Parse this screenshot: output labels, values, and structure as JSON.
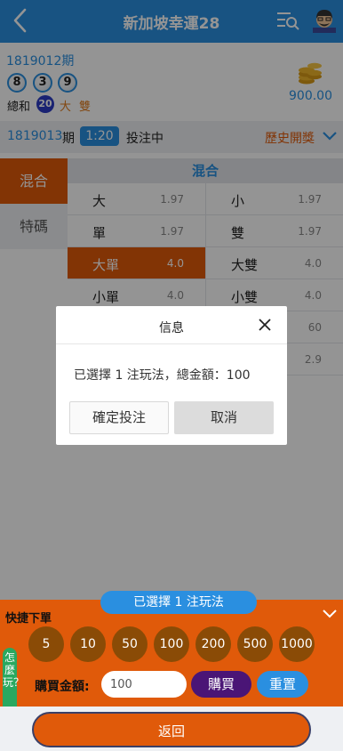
{
  "header": {
    "title": "新加坡幸運28",
    "back_icon": "chevron-left-icon",
    "menu_icon": "list-search-icon",
    "avatar_icon": "user-avatar-icon"
  },
  "last_draw": {
    "issue": "1819012期",
    "balls": [
      "8",
      "3",
      "9"
    ],
    "sum_label": "總和",
    "sum": "20",
    "attr_size": "大",
    "attr_parity": "雙",
    "balance": "900.00",
    "coins_icon": "coins-stack-icon"
  },
  "current": {
    "issue": "1819013",
    "issue_suffix": "期",
    "timer": "1:20",
    "status": "投注中",
    "history_label": "歷史開獎"
  },
  "tabs": [
    {
      "label": "混合",
      "active": true
    },
    {
      "label": "特碼",
      "active": false
    }
  ],
  "grid": {
    "header": "混合",
    "rows": [
      [
        {
          "name": "大",
          "odds": "1.97",
          "selected": false
        },
        {
          "name": "小",
          "odds": "1.97",
          "selected": false
        }
      ],
      [
        {
          "name": "單",
          "odds": "1.97",
          "selected": false
        },
        {
          "name": "雙",
          "odds": "1.97",
          "selected": false
        }
      ],
      [
        {
          "name": "大單",
          "odds": "4.0",
          "selected": true
        },
        {
          "name": "大雙",
          "odds": "4.0",
          "selected": false
        }
      ],
      [
        {
          "name": "小單",
          "odds": "4.0",
          "selected": false
        },
        {
          "name": "小雙",
          "odds": "4.0",
          "selected": false
        }
      ],
      [
        {
          "name": "",
          "odds": "",
          "selected": false
        },
        {
          "name": "",
          "odds": "60",
          "selected": false
        }
      ],
      [
        {
          "name": "",
          "odds": "",
          "selected": false
        },
        {
          "name": "",
          "odds": "2.9",
          "selected": false
        }
      ]
    ]
  },
  "dialog": {
    "title": "信息",
    "message": "已選擇 1 注玩法，總金額：100",
    "confirm_label": "確定投注",
    "cancel_label": "取消"
  },
  "bet_panel": {
    "selected_label": "已選擇 1 注玩法",
    "quick_label": "快捷下單",
    "howto_label": "怎麼玩？",
    "chips": [
      "5",
      "10",
      "50",
      "100",
      "200",
      "500",
      "1000"
    ],
    "amount_label": "購買金額:",
    "amount_value": "100",
    "buy_label": "購買",
    "reset_label": "重置"
  },
  "footer": {
    "return_label": "返回"
  },
  "colors": {
    "primary_blue": "#2a8fe0",
    "accent_orange": "#e05a0a",
    "chip_brown": "#8a4b06",
    "buy_purple": "#4a1576"
  }
}
